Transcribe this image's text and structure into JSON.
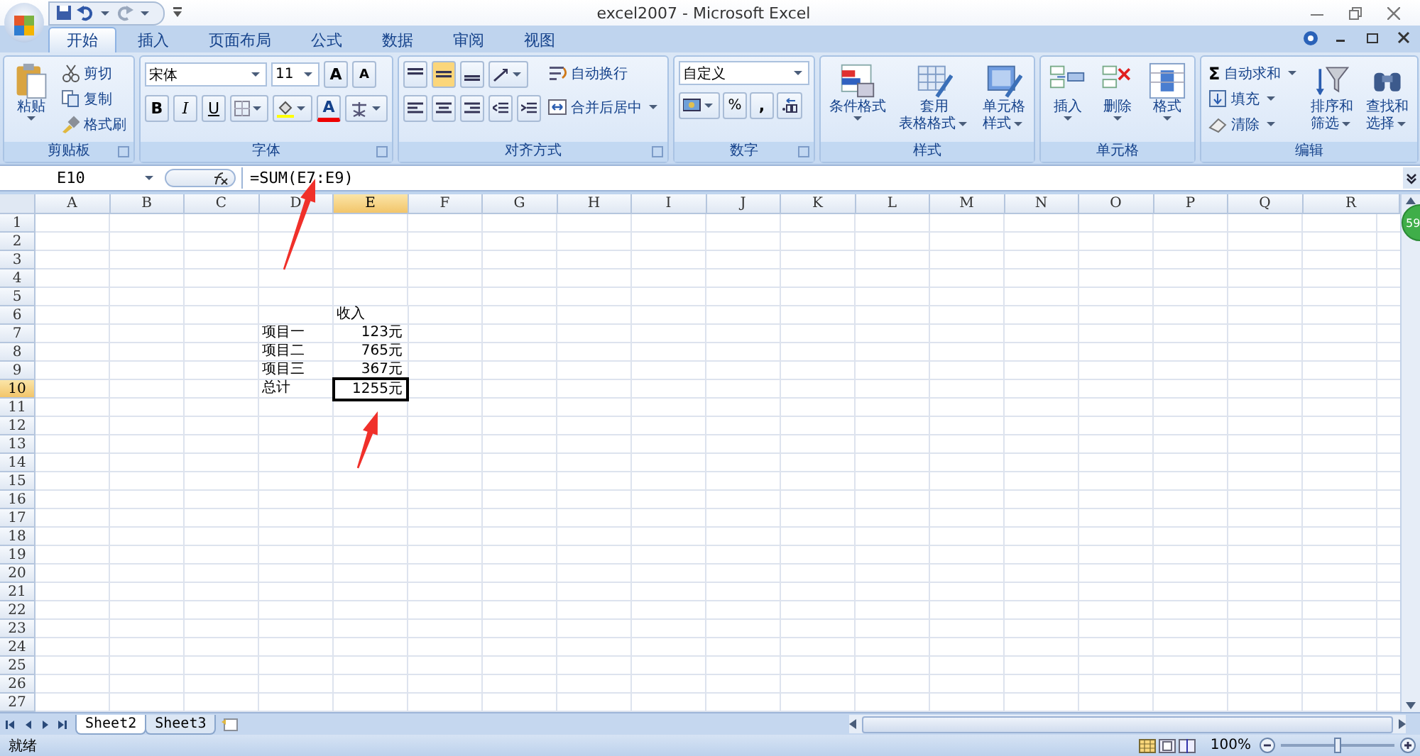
{
  "window": {
    "title": "excel2007 - Microsoft Excel"
  },
  "tabs": [
    {
      "label": "开始",
      "selected": true
    },
    {
      "label": "插入",
      "selected": false
    },
    {
      "label": "页面布局",
      "selected": false
    },
    {
      "label": "公式",
      "selected": false
    },
    {
      "label": "数据",
      "selected": false
    },
    {
      "label": "审阅",
      "selected": false
    },
    {
      "label": "视图",
      "selected": false
    }
  ],
  "ribbon": {
    "groups": [
      {
        "label": "剪贴板",
        "items": [
          {
            "kind": "large",
            "lines": [
              "粘贴"
            ]
          },
          {
            "kind": "small",
            "label": "剪切"
          },
          {
            "kind": "small",
            "label": "复制"
          },
          {
            "kind": "small",
            "label": "格式刷"
          }
        ]
      },
      {
        "label": "字体",
        "font": "宋体",
        "size": "11",
        "grow": "A",
        "shrink": "A",
        "bold": "B",
        "italic": "I",
        "underline": "U",
        "font_color": "A"
      },
      {
        "label": "对齐方式",
        "items": [
          {
            "kind": "small",
            "label": "自动换行"
          },
          {
            "kind": "small",
            "label": "合并后居中"
          }
        ]
      },
      {
        "label": "数字",
        "format": "自定义",
        "percent": "%",
        "comma": ","
      },
      {
        "label": "样式",
        "items": [
          {
            "kind": "large",
            "lines": [
              "条件格式"
            ]
          },
          {
            "kind": "large",
            "lines": [
              "套用",
              "表格格式"
            ]
          },
          {
            "kind": "large",
            "lines": [
              "单元格",
              "样式"
            ]
          }
        ]
      },
      {
        "label": "单元格",
        "items": [
          {
            "kind": "large",
            "lines": [
              "插入"
            ]
          },
          {
            "kind": "large",
            "lines": [
              "删除"
            ]
          },
          {
            "kind": "large",
            "lines": [
              "格式"
            ]
          }
        ]
      },
      {
        "label": "编辑",
        "items": [
          {
            "kind": "small",
            "glyph": "Σ",
            "label": "自动求和"
          },
          {
            "kind": "small",
            "label": "填充"
          },
          {
            "kind": "small",
            "label": "清除"
          },
          {
            "kind": "large",
            "lines": [
              "排序和",
              "筛选"
            ]
          },
          {
            "kind": "large",
            "lines": [
              "查找和",
              "选择"
            ]
          }
        ]
      }
    ]
  },
  "formula_bar": {
    "name_box": "E10",
    "formula": "=SUM(E7:E9)"
  },
  "sheet": {
    "columns": [
      "A",
      "B",
      "C",
      "D",
      "E",
      "F",
      "G",
      "H",
      "I",
      "J",
      "K",
      "L",
      "M",
      "N",
      "O",
      "P",
      "Q",
      "R"
    ],
    "rows": [
      {
        "header": "1"
      },
      {
        "header": "2"
      },
      {
        "header": "3"
      },
      {
        "header": "4"
      },
      {
        "header": "5"
      },
      {
        "header": "6",
        "column_e": {
          "kind": "text",
          "text": "收入",
          "selected": false
        }
      },
      {
        "header": "7",
        "column_d": {
          "kind": "text",
          "text": "项目一",
          "selected": false
        },
        "column_e": {
          "kind": "number",
          "text": "123元",
          "selected": false
        }
      },
      {
        "header": "8",
        "column_d": {
          "kind": "text",
          "text": "项目二",
          "selected": false
        },
        "column_e": {
          "kind": "number",
          "text": "765元",
          "selected": false
        }
      },
      {
        "header": "9",
        "column_d": {
          "kind": "text",
          "text": "项目三",
          "selected": false
        },
        "column_e": {
          "kind": "number",
          "text": "367元",
          "selected": false
        }
      },
      {
        "header": "10",
        "column_d": {
          "kind": "text",
          "text": "总计",
          "selected": false
        },
        "column_e": {
          "kind": "number",
          "text": "1255元",
          "selected": true
        }
      },
      {
        "header": "11"
      },
      {
        "header": "12"
      },
      {
        "header": "13"
      },
      {
        "header": "14"
      },
      {
        "header": "15"
      },
      {
        "header": "16"
      },
      {
        "header": "17"
      },
      {
        "header": "18"
      },
      {
        "header": "19"
      },
      {
        "header": "20"
      },
      {
        "header": "21"
      },
      {
        "header": "22"
      },
      {
        "header": "23"
      },
      {
        "header": "24"
      },
      {
        "header": "25"
      },
      {
        "header": "26"
      },
      {
        "header": "27"
      }
    ]
  },
  "badge": {
    "text": "59"
  },
  "sheet_tabs": [
    {
      "label": "Sheet2",
      "selected": true
    },
    {
      "label": "Sheet3",
      "selected": false
    }
  ],
  "status_bar": {
    "status": "就绪",
    "zoom": "100%",
    "zoom_level": {
      "level": 0.5
    }
  }
}
